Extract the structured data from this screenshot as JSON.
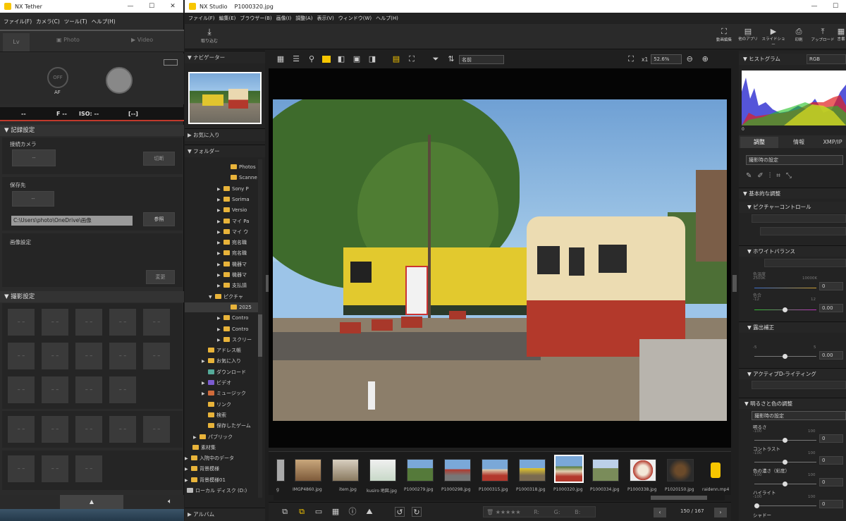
{
  "tether": {
    "title": "NX Tether",
    "menu": [
      "ファイル(F)",
      "カメラ(C)",
      "ツール(T)",
      "ヘルプ(H)"
    ],
    "tabs": {
      "lv": "Lv",
      "photo": "Photo",
      "video": "Video"
    },
    "af_off": "OFF",
    "af": "AF",
    "info": {
      "a": "--",
      "f": "F --",
      "iso": "ISO: --",
      "b": "[--]"
    },
    "record_section": "記録設定",
    "camera_label": "接続カメラ",
    "camera_value": "--",
    "disconnect": "切断",
    "save_label": "保存先",
    "save_value": "--",
    "path": "C:\\Users\\photo\\OneDrive\\画像",
    "browse": "参照",
    "image_settings": "画像設定",
    "change": "変更",
    "shoot_section": "撮影設定",
    "cell": "– –"
  },
  "studio": {
    "title": "NX Studio",
    "file": "P1000320.jpg",
    "menu": [
      "ファイル(F)",
      "編集(E)",
      "ブラウザー(B)",
      "画像(I)",
      "調整(A)",
      "表示(V)",
      "ウィンドウ(W)",
      "ヘルプ(H)"
    ],
    "import": "取り込む",
    "tools": [
      "動画編集",
      "他のアプリ",
      "スライドショー",
      "印刷",
      "アップロード",
      "言書"
    ],
    "nav": {
      "navigator": "ナビゲーター",
      "favorites": "お気に入り",
      "folders": "フォルダー",
      "album": "アルバム"
    },
    "folders": [
      "Photos",
      "Scanne",
      "Sony P",
      "Sorima",
      "Versio",
      "マイ Pa",
      "マイ ウ",
      "宛名職",
      "宛名職",
      "機器マ",
      "機器マ",
      "支払請",
      "ピクチャ",
      "2025",
      "Contro",
      "Contro",
      "スクリー",
      "アドレス帳",
      "お気に入り",
      "ダウンロード",
      "ビデオ",
      "ミュージック",
      "リンク",
      "検索",
      "保存したゲーム",
      "パブリック",
      "素材集",
      "入院中のデータ",
      "背景模様",
      "背景模様01",
      "ローカル ディスク (D:)"
    ],
    "sort": "名前",
    "zoom_x": "x1",
    "zoom": "52.6%",
    "thumbs": [
      "g",
      "IMGP4860.jpg",
      "item.jpg",
      "kusiro 地図.jpg",
      "P1000279.jpg",
      "P1000298.jpg",
      "P1000315.jpg",
      "P1000318.jpg",
      "P1000320.jpg",
      "P1000334.jpg",
      "P1000338.jpg",
      "P1020150.jpg",
      "raidenn.mp4"
    ],
    "status": {
      "r": "R:",
      "g": "G:",
      "b": "B:",
      "count": "150 / 167"
    },
    "right": {
      "histogram": "ヒストグラム",
      "channel": "RGB",
      "hist_zero": "0",
      "tabs": [
        "調整",
        "情報",
        "XMP/IP"
      ],
      "preset": "撮影時の設定",
      "basic": "基本的な調整",
      "picture_control": "ピクチャーコントロール",
      "wb": "ホワイトバランス",
      "temp": "色温度",
      "temp_min": "2500K",
      "temp_max": "10000K",
      "tint": "色合",
      "tint_min": "-12",
      "tint_max": "12",
      "wb_val1": "0",
      "wb_val2": "0.00",
      "exposure": "露出補正",
      "exp_min": "-5",
      "exp_max": "5",
      "exp_val": "0.00",
      "adl": "アクティブD-ライティング",
      "bright_color": "明るさと色の調整",
      "bright_preset": "撮影時の設定",
      "brightness": "明るさ",
      "contrast": "コントラスト",
      "saturation": "色の濃さ（彩度）",
      "highlight": "ハイライト",
      "shadow": "シャドー",
      "min": "-100",
      "max": "100",
      "zero": "0"
    }
  }
}
